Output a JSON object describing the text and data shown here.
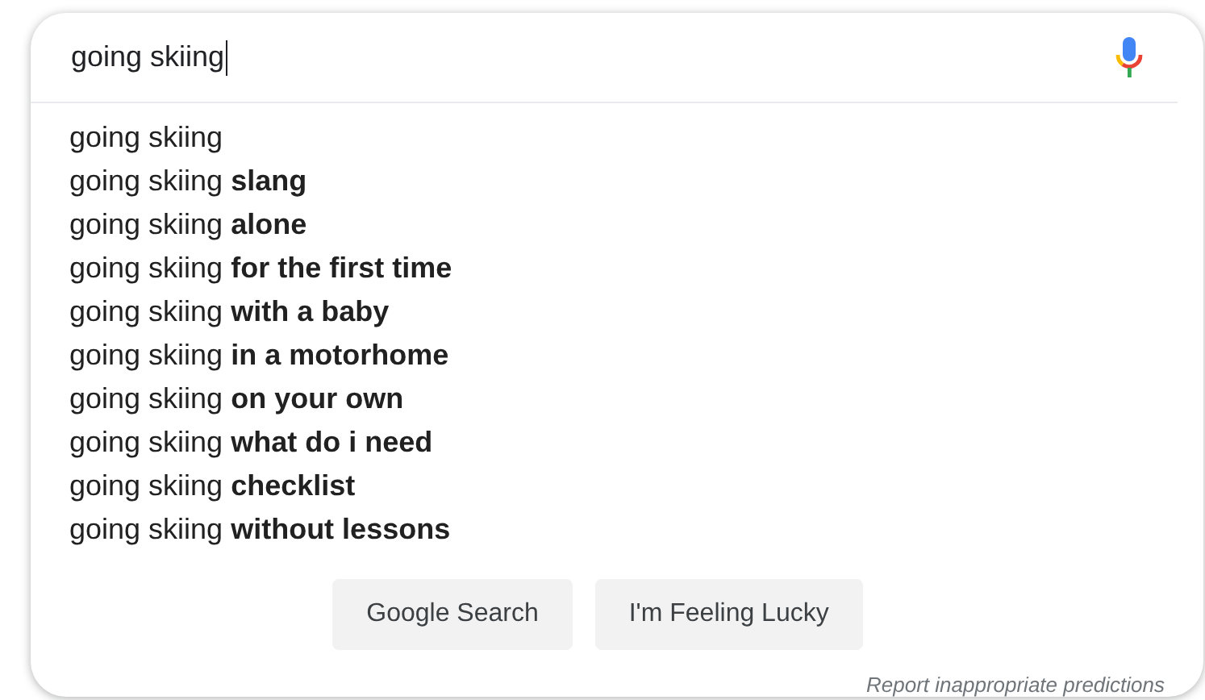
{
  "search": {
    "value": "going skiing"
  },
  "suggestions": [
    "going skiing",
    "going skiing **slang**",
    "going skiing **alone**",
    "going skiing **for the first time**",
    "going skiing **with a baby**",
    "going skiing **in a motorhome**",
    "going skiing **on your own**",
    "going skiing **what do i need**",
    "going skiing **checklist**",
    "going skiing **without lessons**"
  ],
  "buttons": [
    "Google Search",
    "I'm Feeling Lucky"
  ],
  "report_link": "Report inappropriate predictions"
}
